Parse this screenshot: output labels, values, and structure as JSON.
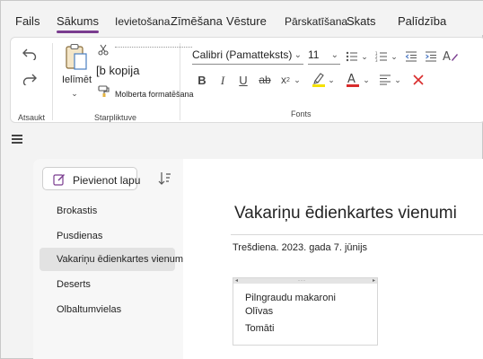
{
  "menu": {
    "items": [
      "Fails",
      "Sākums",
      "Ievietošana",
      "Zīmēšana",
      "Vēsture",
      "Pārskatīšana",
      "Skats",
      "Palīdzība"
    ],
    "active": "Sākums"
  },
  "ribbon": {
    "undo": {
      "label": "Atsaukt"
    },
    "clipboard": {
      "paste_label": "Ielīmēt",
      "copy_label": "[b kopija",
      "format_painter_label": "Molberta formatēšana",
      "group_label": "Starpliktuve"
    },
    "font": {
      "font_name": "Calibri (Pamatteksts)",
      "font_size": "11",
      "bold": "B",
      "italic": "I",
      "underline": "U",
      "strike": "ab",
      "subscript": "x",
      "group_label": "Fonts"
    },
    "colors": {
      "highlight": "#f5e100",
      "font_color": "#d92c2c",
      "accent": "#7a3c8f"
    }
  },
  "pages": {
    "add_page_label": "Pievienot lapu",
    "items": [
      "Brokastis",
      "Pusdienas",
      "Vakariņu ēdienkartes vienumi",
      "Deserts",
      "Olbaltumvielas"
    ],
    "selected_index": 2
  },
  "page": {
    "title": "Vakariņu ēdienkartes vienumi",
    "date": "Trešdiena. 2023. gada 7. jūnijs",
    "note_lines": [
      "Pilngraudu makaroni",
      "Olīvas",
      "Tomāti"
    ]
  }
}
